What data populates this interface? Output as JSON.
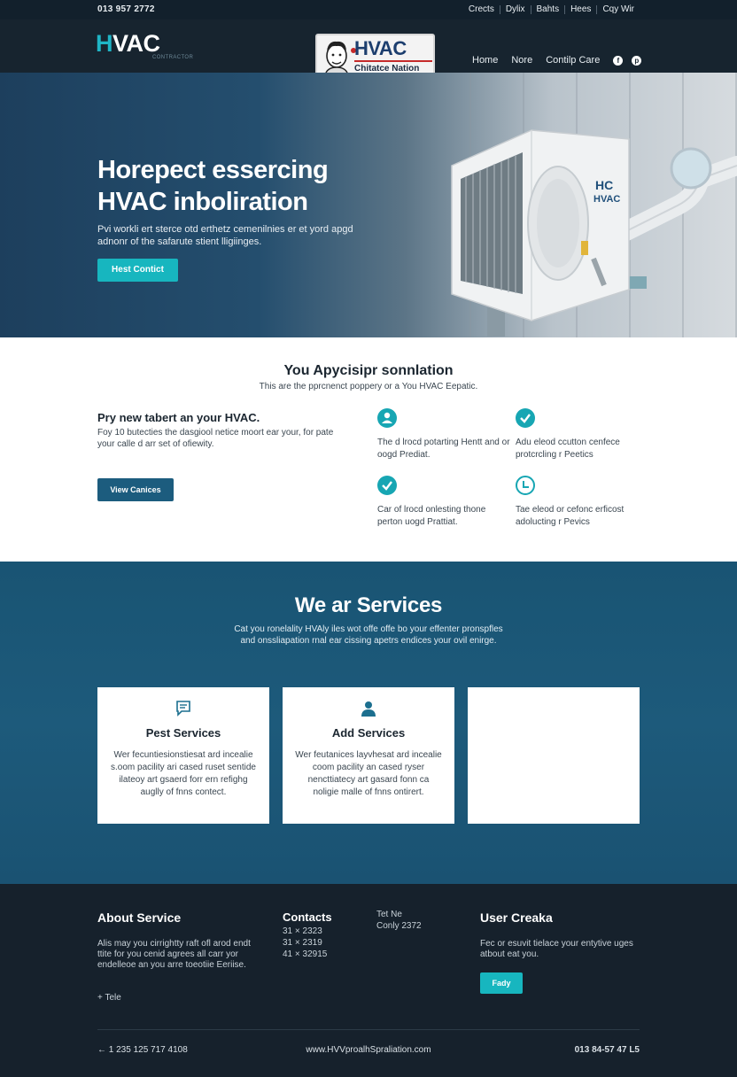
{
  "topbar": {
    "phone": "013 957 2772",
    "links": [
      "Crects",
      "Dylix",
      "Bahts",
      "Hees",
      "Cqy Wir"
    ]
  },
  "header": {
    "logo": "HVAC",
    "logo_sub": "CONTRACTOR",
    "badge": {
      "title": "HVAC",
      "subtitle": "Chitatce Nation"
    },
    "nav": [
      "Home",
      "Nore",
      "Contilp Care"
    ],
    "social_icons": [
      "facebook-icon",
      "pinterest-icon"
    ]
  },
  "hero": {
    "heading": "Horepect essercing HVAC inboliration",
    "text": "Pvi workli ert sterce otd erthetz cemenilnies er et yord apgd adnonr of the safarute stient lligiinges.",
    "cta": "Hest Contict",
    "unit_label_1": "HC",
    "unit_label_2": "HVAC"
  },
  "intro": {
    "title": "You Apycisipr sonnlation",
    "subtitle": "This are the pprcnenct poppery or a You HVAC Eepatic.",
    "left_heading": "Pry new tabert an your HVAC.",
    "left_text": "Foy 10 butecties the dasgiool netice moort ear your, for pate your calle d arr set of ofiewity.",
    "button": "View Canices",
    "features": [
      {
        "icon": "user-icon",
        "text": "The d lrocd potarting Hentt and or oogd Prediat."
      },
      {
        "icon": "check-icon",
        "text": "Adu eleod ccutton cenfece protcrcling r Peetics"
      },
      {
        "icon": "check-icon",
        "text": "Car of lrocd onlesting thone perton uogd Prattiat."
      },
      {
        "icon": "clock-icon",
        "text": "Tae eleod or cefonc erficost adolucting r Pevics"
      }
    ]
  },
  "services": {
    "title": "We ar Services",
    "subtitle": "Cat you ronelality HVAly iles wot offe offe bo your effenter pronspfles and onssliapation rnal ear cissing apetrs endices your ovil enirge.",
    "cards": [
      {
        "icon": "chat-icon",
        "title": "Pest Services",
        "text": "Wer fecuntiesionstiesat ard incealie s.oom pacility ari cased ruset sentide ilateoy art gsaerd forr ern refighg auglly of fnns contect."
      },
      {
        "icon": "user-icon",
        "title": "Add Services",
        "text": "Wer feutanices layvhesat ard incealie coom pacility an cased ryser nencttiatecy art gasard fonn ca noligie malle of fnns ontirert."
      },
      {
        "icon": "",
        "title": "",
        "text": ""
      }
    ]
  },
  "footer": {
    "about_title": "About Service",
    "about_text": "Alis may you cirrightty raft ofl arod endt ttite for you cenid agrees all carr yor endelleoe an you arre toeotiie Eeriise.",
    "about_link": "Tele",
    "contacts_title": "Contacts",
    "contacts_lines": [
      "31 × 2323",
      "31 × 2319",
      "41 × 32915"
    ],
    "tel_title": "Tet Ne",
    "tel_text": "Conly 2372",
    "user_title": "User Creaka",
    "user_text": "Fec or esuvit tielace your entytive uges atbout eat you.",
    "user_button": "Fady",
    "bottom_left": "1 235 125 717 4108",
    "bottom_center": "www.HVVproalhSpraliation.com",
    "bottom_right": "013 84-57 47 L5"
  }
}
